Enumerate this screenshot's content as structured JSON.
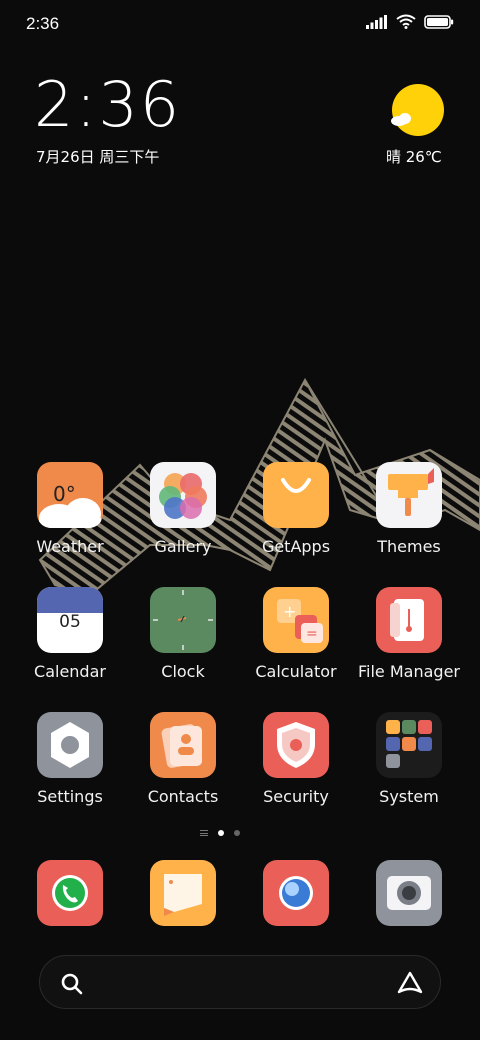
{
  "status_bar": {
    "time": "2:36"
  },
  "widget": {
    "time": "2:36",
    "date": "7月26日 周三下午",
    "weather": "晴 26℃"
  },
  "apps": [
    {
      "label": "Weather"
    },
    {
      "label": "Gallery"
    },
    {
      "label": "GetApps"
    },
    {
      "label": "Themes"
    },
    {
      "label": "Calendar"
    },
    {
      "label": "Clock"
    },
    {
      "label": "Calculator"
    },
    {
      "label": "File Manager"
    },
    {
      "label": "Settings"
    },
    {
      "label": "Contacts"
    },
    {
      "label": "Security"
    },
    {
      "label": "System"
    }
  ],
  "weather_icon_temp": "0°",
  "calendar_icon_day": "05",
  "dock": [
    "phone",
    "messages",
    "browser",
    "camera"
  ],
  "colors": {
    "orange": "#f08a4b",
    "yellow": "#ffb14a",
    "red": "#ea5f57",
    "gray": "#8e939c",
    "blue": "#5566b0",
    "green": "#5b8a60"
  }
}
